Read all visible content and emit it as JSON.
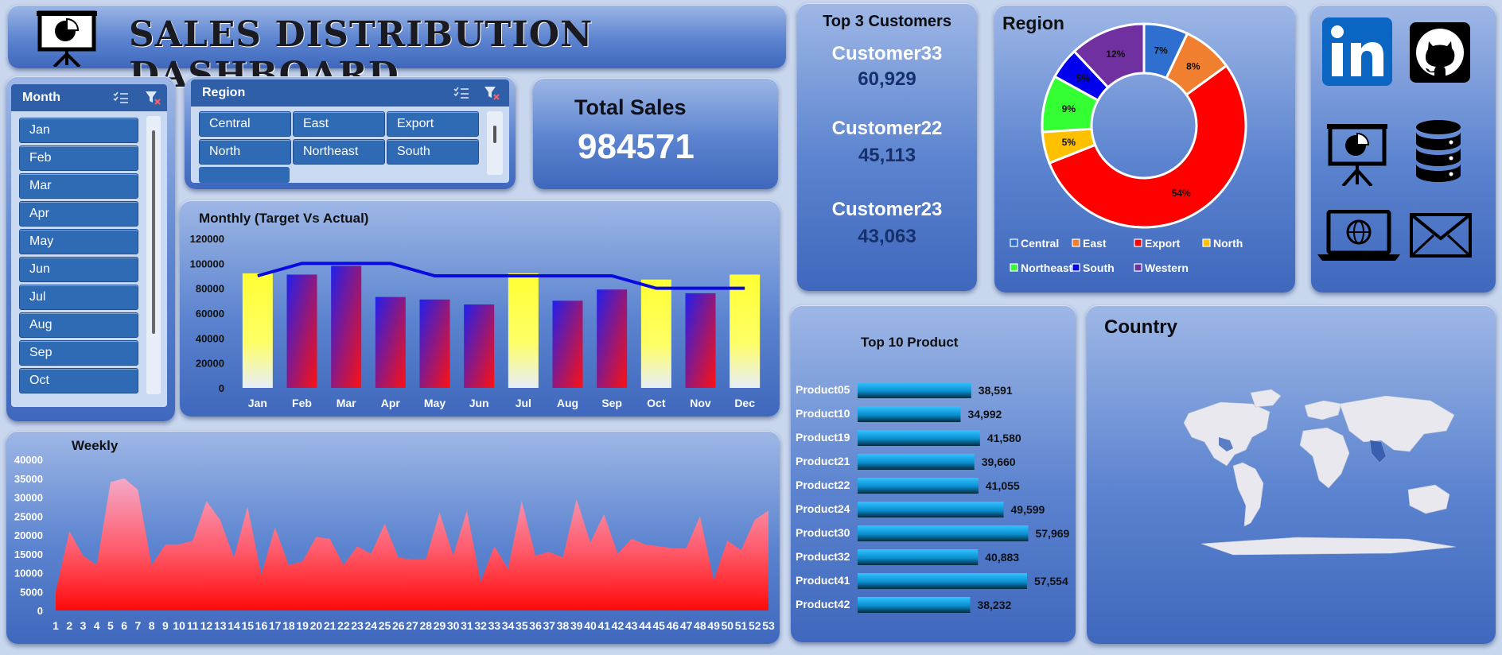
{
  "title": "SALES DISTRIBUTION DASHBOARD",
  "month_slicer": {
    "label": "Month",
    "items": [
      "Jan",
      "Feb",
      "Mar",
      "Apr",
      "May",
      "Jun",
      "Jul",
      "Aug",
      "Sep",
      "Oct"
    ]
  },
  "region_slicer": {
    "label": "Region",
    "items": [
      "Central",
      "East",
      "Export",
      "North",
      "Northeast",
      "South"
    ]
  },
  "total_sales": {
    "label": "Total Sales",
    "value": "984571"
  },
  "top_customers": {
    "label": "Top 3 Customers",
    "items": [
      {
        "name": "Customer33",
        "value": "60,929"
      },
      {
        "name": "Customer22",
        "value": "45,113"
      },
      {
        "name": "Customer23",
        "value": "43,063"
      }
    ]
  },
  "colors": {
    "yellow_bar": "#ffff33",
    "blue_bar": "#2020ee",
    "red_bar": "#ff1010",
    "target_line": "#0a0ae0"
  },
  "chart_data": [
    {
      "type": "bar",
      "title": "Monthly (Target Vs Actual)",
      "categories": [
        "Jan",
        "Feb",
        "Mar",
        "Apr",
        "May",
        "Jun",
        "Jul",
        "Aug",
        "Sep",
        "Oct",
        "Nov",
        "Dec"
      ],
      "series": [
        {
          "values": [
            92000,
            91000,
            98000,
            73000,
            71000,
            67000,
            92000,
            70000,
            79000,
            87000,
            76000,
            91000
          ]
        },
        {
          "values": [
            90000,
            100000,
            100000,
            100000,
            90000,
            90000,
            90000,
            90000,
            90000,
            80000,
            80000,
            80000
          ]
        }
      ],
      "ylim": [
        0,
        120000
      ],
      "yticks": [
        "0",
        "20000",
        "40000",
        "60000",
        "80000",
        "100000",
        "120000"
      ]
    },
    {
      "type": "area",
      "title": "Weekly",
      "x": [
        1,
        2,
        3,
        4,
        5,
        6,
        7,
        8,
        9,
        10,
        11,
        12,
        13,
        14,
        15,
        16,
        17,
        18,
        19,
        20,
        21,
        22,
        23,
        24,
        25,
        26,
        27,
        28,
        29,
        30,
        31,
        32,
        33,
        34,
        35,
        36,
        37,
        38,
        39,
        40,
        41,
        42,
        43,
        44,
        45,
        46,
        47,
        48,
        49,
        50,
        51,
        52,
        53
      ],
      "values": [
        5000,
        21000,
        14500,
        12000,
        34000,
        35000,
        32000,
        12000,
        17500,
        17500,
        18500,
        29000,
        24000,
        14000,
        27500,
        9500,
        22000,
        12000,
        13000,
        19500,
        19000,
        12000,
        17000,
        15000,
        23000,
        14000,
        13500,
        13500,
        26000,
        14500,
        26500,
        7500,
        17000,
        11000,
        29000,
        14500,
        15500,
        14000,
        29500,
        18000,
        25500,
        15000,
        19000,
        17500,
        17000,
        16500,
        16500,
        25000,
        8000,
        18500,
        16000,
        24000,
        26500
      ],
      "ylim": [
        0,
        40000
      ],
      "yticks": [
        "0",
        "5000",
        "10000",
        "15000",
        "20000",
        "25000",
        "30000",
        "35000",
        "40000"
      ]
    },
    {
      "type": "pie",
      "title": "Region",
      "categories": [
        "Central",
        "East",
        "Export",
        "North",
        "Northeast",
        "South",
        "Western"
      ],
      "values": [
        7,
        8,
        54,
        5,
        9,
        5,
        12
      ],
      "labels": [
        "7%",
        "8%",
        "54%",
        "5%",
        "9%",
        "5%",
        "12%"
      ],
      "colors": [
        "#2f6fd0",
        "#f07f30",
        "#ff0000",
        "#ffc000",
        "#33ff33",
        "#0000ee",
        "#7030a0"
      ]
    },
    {
      "type": "bar",
      "title": "Top 10 Product",
      "categories": [
        "Product05",
        "Product10",
        "Product19",
        "Product21",
        "Product22",
        "Product24",
        "Product30",
        "Product32",
        "Product41",
        "Product42"
      ],
      "values": [
        38591,
        34992,
        41580,
        39660,
        41055,
        49599,
        57969,
        40883,
        57554,
        38232
      ],
      "labels": [
        "38,591",
        "34,992",
        "41,580",
        "39,660",
        "41,055",
        "49,599",
        "57,969",
        "40,883",
        "57,554",
        "38,232"
      ]
    }
  ],
  "country": {
    "label": "Country"
  },
  "icons": [
    "linkedin-icon",
    "github-icon",
    "presentation-chart-icon",
    "database-icon",
    "laptop-globe-icon",
    "mail-icon"
  ]
}
